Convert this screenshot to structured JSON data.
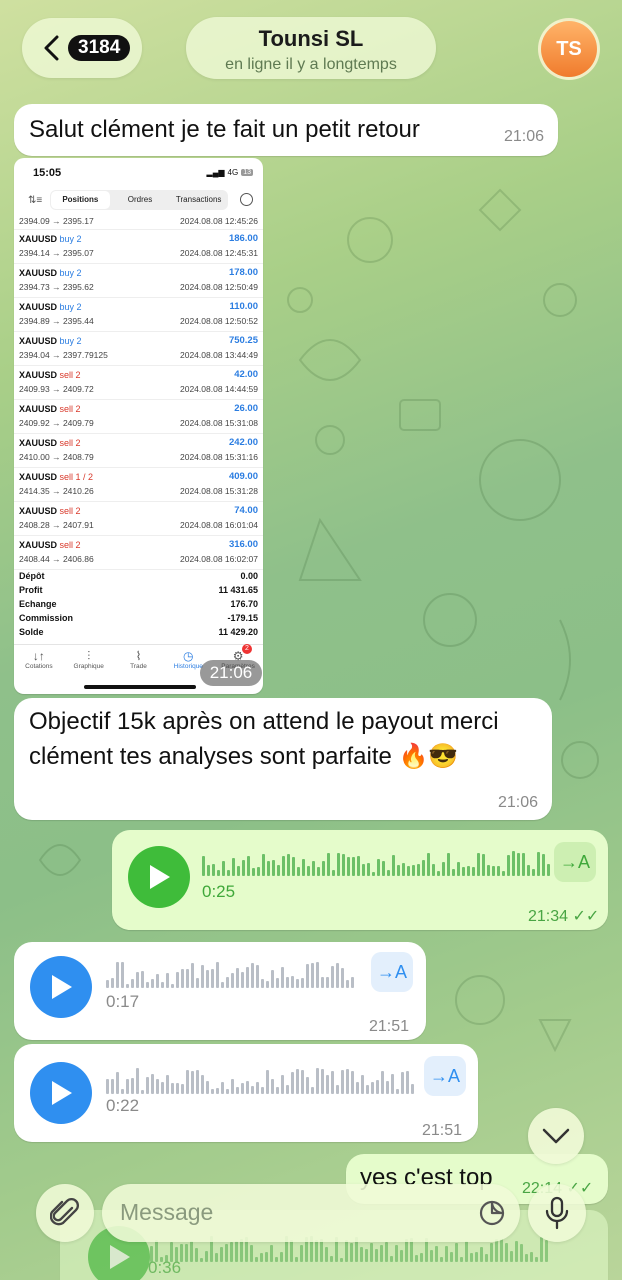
{
  "header": {
    "back_count": "3184",
    "chat_name": "Tounsi SL",
    "status": "en ligne il y a longtemps",
    "avatar_initials": "TS"
  },
  "messages": {
    "m1": {
      "text": "Salut clément je te fait un petit retour",
      "time": "21:06"
    },
    "m2": {
      "time": "21:06"
    },
    "m3": {
      "text": "Objectif 15k après on attend le payout merci clément tes analyses sont parfaite 🔥😎",
      "time": "21:06"
    },
    "v1": {
      "duration": "0:25",
      "time": "21:34",
      "translate": "→A"
    },
    "v2": {
      "duration": "0:17",
      "time": "21:51",
      "translate": "→A"
    },
    "v3": {
      "duration": "0:22",
      "time": "21:51",
      "translate": "→A"
    },
    "m7": {
      "text": "yes c'est top",
      "time": "22:14"
    },
    "ghost": {
      "duration": "0:36"
    }
  },
  "screenshot": {
    "clock": "15:05",
    "network": "4G",
    "battery": "13",
    "tabs": [
      "Positions",
      "Ordres",
      "Transactions"
    ],
    "first_row": {
      "prices": "2394.09 → 2395.17",
      "date": "2024.08.08 12:45:26"
    },
    "rows": [
      {
        "symbol": "XAUUSD",
        "side": "buy 2",
        "type": "buy",
        "prices": "2394.14 → 2395.07",
        "profit": "186.00",
        "date": "2024.08.08 12:45:31"
      },
      {
        "symbol": "XAUUSD",
        "side": "buy 2",
        "type": "buy",
        "prices": "2394.73 → 2395.62",
        "profit": "178.00",
        "date": "2024.08.08 12:50:49"
      },
      {
        "symbol": "XAUUSD",
        "side": "buy 2",
        "type": "buy",
        "prices": "2394.89 → 2395.44",
        "profit": "110.00",
        "date": "2024.08.08 12:50:52"
      },
      {
        "symbol": "XAUUSD",
        "side": "buy 2",
        "type": "buy",
        "prices": "2394.04 → 2397.79125",
        "profit": "750.25",
        "date": "2024.08.08 13:44:49"
      },
      {
        "symbol": "XAUUSD",
        "side": "sell 2",
        "type": "sell",
        "prices": "2409.93 → 2409.72",
        "profit": "42.00",
        "date": "2024.08.08 14:44:59"
      },
      {
        "symbol": "XAUUSD",
        "side": "sell 2",
        "type": "sell",
        "prices": "2409.92 → 2409.79",
        "profit": "26.00",
        "date": "2024.08.08 15:31:08"
      },
      {
        "symbol": "XAUUSD",
        "side": "sell 2",
        "type": "sell",
        "prices": "2410.00 → 2408.79",
        "profit": "242.00",
        "date": "2024.08.08 15:31:16"
      },
      {
        "symbol": "XAUUSD",
        "side": "sell 1 / 2",
        "type": "sell",
        "prices": "2414.35 → 2410.26",
        "profit": "409.00",
        "date": "2024.08.08 15:31:28"
      },
      {
        "symbol": "XAUUSD",
        "side": "sell 2",
        "type": "sell",
        "prices": "2408.28 → 2407.91",
        "profit": "74.00",
        "date": "2024.08.08 16:01:04"
      },
      {
        "symbol": "XAUUSD",
        "side": "sell 2",
        "type": "sell",
        "prices": "2408.44 → 2406.86",
        "profit": "316.00",
        "date": "2024.08.08 16:02:07"
      }
    ],
    "summary": [
      {
        "label": "Dépôt",
        "value": "0.00"
      },
      {
        "label": "Profit",
        "value": "11 431.65"
      },
      {
        "label": "Echange",
        "value": "176.70"
      },
      {
        "label": "Commission",
        "value": "-179.15"
      },
      {
        "label": "Solde",
        "value": "11 429.20"
      }
    ],
    "nav": [
      "Cotations",
      "Graphique",
      "Trade",
      "Historique",
      "Paramètres"
    ],
    "nav_badge": "2"
  },
  "input": {
    "placeholder": "Message"
  },
  "colors": {
    "outgoing_bubble": "#e5fccb",
    "incoming_bubble": "#ffffff",
    "accent_green": "#3fbc3a",
    "accent_blue": "#2f8ff0"
  }
}
